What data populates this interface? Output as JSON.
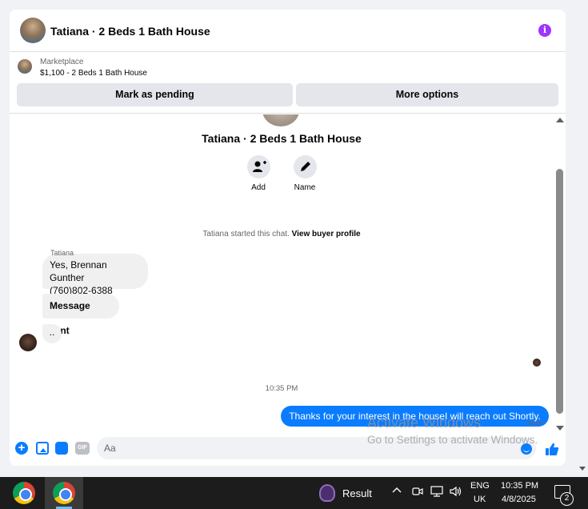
{
  "header": {
    "title": "Tatiana · 2 Beds 1 Bath House",
    "info_glyph": "i"
  },
  "marketplace": {
    "label": "Marketplace",
    "listing": "$1,100 - 2 Beds 1 Bath House",
    "mark_pending_label": "Mark as pending",
    "more_options_label": "More options"
  },
  "chat": {
    "title": "Tatiana · 2 Beds 1 Bath House",
    "actions": [
      {
        "label": "Add",
        "icon": "add-person-icon"
      },
      {
        "label": "Name",
        "icon": "pencil-icon"
      }
    ],
    "started_text": "Tatiana started this chat.",
    "view_profile_label": "View buyer profile",
    "sender_name": "Tatiana",
    "messages_in": [
      "Yes, Brennan Gunther\n(760)802-6388",
      "Message sent",
      ".."
    ],
    "timestamp": "10:35 PM",
    "message_out": "Thanks for your interest in the houseI will reach out Shortly.",
    "sent_status": "Sent"
  },
  "composer": {
    "placeholder": "Aa",
    "value": "",
    "gif_label": "GIF",
    "plus_glyph": "+"
  },
  "watermark": {
    "line1": "Activate Windows",
    "line2": "Go to Settings to activate Windows."
  },
  "taskbar": {
    "app_label": "Result",
    "tray_chevron": "^",
    "language_line1": "ENG",
    "language_line2": "UK",
    "time": "10:35 PM",
    "date": "4/8/2025",
    "notification_count": "2"
  },
  "colors": {
    "accent": "#0a7cff",
    "info": "#a033ff",
    "bubble_in": "#f0f0f0",
    "button_bg": "#e4e6eb",
    "taskbar": "#1c1c1c"
  }
}
